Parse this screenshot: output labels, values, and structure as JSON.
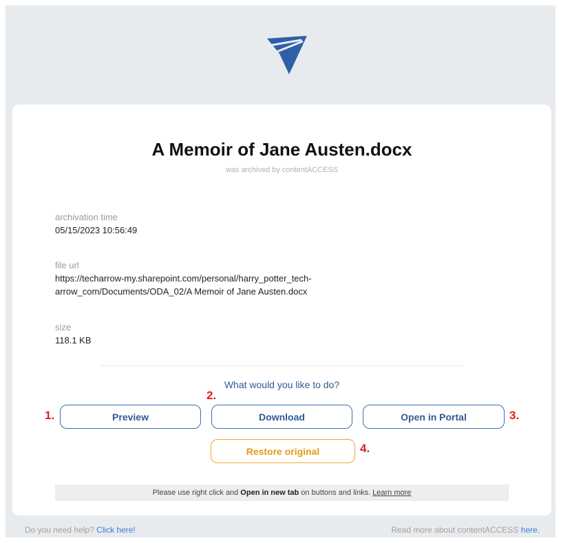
{
  "logo": {
    "icon": "paper-plane-logo",
    "color": "#2f5fa8"
  },
  "file": {
    "name": "A Memoir of Jane Austen.docx",
    "subtitle": "was archived by contentACCESS"
  },
  "fields": {
    "archivation_time": {
      "label": "archivation time",
      "value": "05/15/2023 10:56:49"
    },
    "file_url": {
      "label": "file url",
      "value": "https://techarrow-my.sharepoint.com/personal/harry_potter_tech-arrow_com/Documents/ODA_02/A Memoir of Jane Austen.docx"
    },
    "size": {
      "label": "size",
      "value": "118.1 KB"
    }
  },
  "actions": {
    "question": "What would you like to do?",
    "preview": "Preview",
    "download": "Download",
    "open_in_portal": "Open in Portal",
    "restore_original": "Restore original"
  },
  "annotations": {
    "n1": "1.",
    "n2": "2.",
    "n3": "3.",
    "n4": "4.",
    "color": "#e02020"
  },
  "notice": {
    "prefix": "Please use right click and",
    "bold": "Open in new tab",
    "suffix": "on buttons and links.",
    "link": "Learn more"
  },
  "footer": {
    "help_text": "Do you need help?",
    "help_link": "Click here!",
    "read_more_text": "Read more about contentACCESS",
    "read_more_link": "here."
  },
  "colors": {
    "primary": "#2e5a94",
    "restore": "#e59a12",
    "background": "#e8ebee"
  }
}
